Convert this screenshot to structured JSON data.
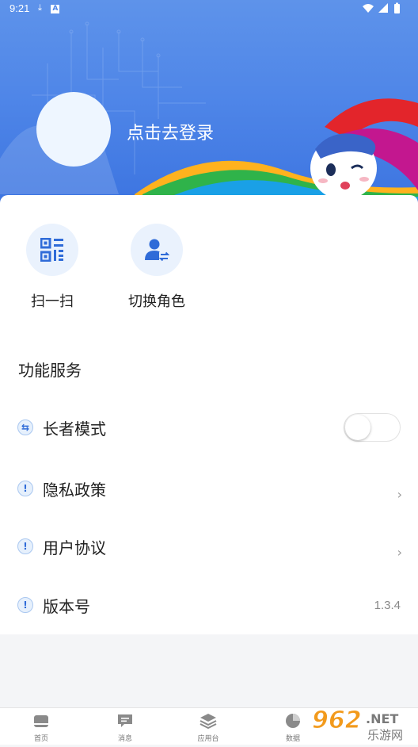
{
  "status_bar": {
    "time": "9:21",
    "left_icons": [
      "download-icon",
      "a-icon"
    ],
    "right_icons": [
      "wifi-icon",
      "signal-icon",
      "battery-icon"
    ]
  },
  "header": {
    "login_text": "点击去登录"
  },
  "quick_actions": [
    {
      "label": "扫一扫",
      "icon": "scan-icon"
    },
    {
      "label": "切换角色",
      "icon": "switch-role-icon"
    }
  ],
  "services": {
    "title": "功能服务",
    "items": [
      {
        "label": "长者模式",
        "icon": "swap-icon",
        "control": "toggle",
        "toggle_on": false
      },
      {
        "label": "隐私政策",
        "icon": "info-icon",
        "control": "chevron"
      },
      {
        "label": "用户协议",
        "icon": "info-icon",
        "control": "chevron"
      },
      {
        "label": "版本号",
        "icon": "info-icon",
        "control": "value",
        "value": "1.3.4"
      }
    ]
  },
  "tabbar": {
    "tabs": [
      {
        "label": "首页",
        "icon": "home-icon"
      },
      {
        "label": "消息",
        "icon": "message-icon"
      },
      {
        "label": "应用台",
        "icon": "layers-icon"
      },
      {
        "label": "数据",
        "icon": "pie-chart-icon"
      }
    ]
  },
  "watermark": {
    "brand": "962",
    "suffix": ".NET",
    "tagline": "乐游网"
  },
  "colors": {
    "header_blue": "#4f86e8",
    "icon_blue": "#2f6bd8",
    "icon_bg": "#eaf2fd"
  }
}
